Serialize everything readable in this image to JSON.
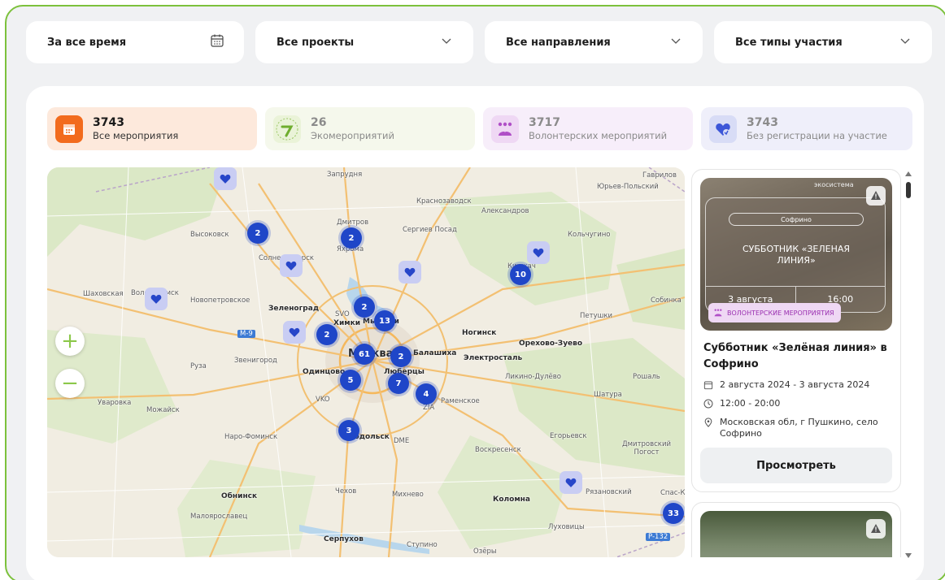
{
  "filters": {
    "period": "За все время",
    "projects": "Все проекты",
    "directions": "Все направления",
    "types": "Все типы участия"
  },
  "stats": [
    {
      "value": "3743",
      "label": "Все мероприятия",
      "icon": "calendar-icon",
      "color": "#f26b1d"
    },
    {
      "value": "26",
      "label": "Экомероприятий",
      "icon": "eco-logo-icon",
      "color": "#7cc13c"
    },
    {
      "value": "3717",
      "label": "Волонтерских мероприятий",
      "icon": "people-icon",
      "color": "#b04fc7"
    },
    {
      "value": "3743",
      "label": "Без регистрации на участие",
      "icon": "heart-icon",
      "color": "#3c56d8"
    }
  ],
  "map": {
    "places": [
      {
        "name": "Запрудня"
      },
      {
        "name": "Гаврилов"
      },
      {
        "name": "Юрьев-Польский"
      },
      {
        "name": "Краснозаводск"
      },
      {
        "name": "Александров"
      },
      {
        "name": "Дмитров"
      },
      {
        "name": "Сергиев Посад"
      },
      {
        "name": "Высоковск"
      },
      {
        "name": "Кольчугино"
      },
      {
        "name": "Солнечногорск"
      },
      {
        "name": "Яхрома"
      },
      {
        "name": "Киржач"
      },
      {
        "name": "Шаховская"
      },
      {
        "name": "Волоколамск"
      },
      {
        "name": "Новопетровское"
      },
      {
        "name": "Зеленоград"
      },
      {
        "name": "SVO"
      },
      {
        "name": "Химки"
      },
      {
        "name": "Мытищи"
      },
      {
        "name": "Собинка"
      },
      {
        "name": "Петушки"
      },
      {
        "name": "Ногинск"
      },
      {
        "name": "Орехово-Зуево"
      },
      {
        "name": "Руза"
      },
      {
        "name": "Звенигород"
      },
      {
        "name": "Москва"
      },
      {
        "name": "Балашиха"
      },
      {
        "name": "Электросталь"
      },
      {
        "name": "Одинцово"
      },
      {
        "name": "Люберцы"
      },
      {
        "name": "Ликино-Дулёво"
      },
      {
        "name": "Рошаль"
      },
      {
        "name": "Уваровка"
      },
      {
        "name": "Можайск"
      },
      {
        "name": "VKO"
      },
      {
        "name": "Раменское"
      },
      {
        "name": "Шатура"
      },
      {
        "name": "ZIA"
      },
      {
        "name": "Наро-Фоминск"
      },
      {
        "name": "Подольск"
      },
      {
        "name": "DME"
      },
      {
        "name": "Воскресенск"
      },
      {
        "name": "Егорьевск"
      },
      {
        "name": "Дмитровский Погост"
      },
      {
        "name": "Обнинск"
      },
      {
        "name": "Чехов"
      },
      {
        "name": "Михнево"
      },
      {
        "name": "Коломна"
      },
      {
        "name": "Рязановский"
      },
      {
        "name": "Спас-Клепики"
      },
      {
        "name": "Малоярославец"
      },
      {
        "name": "Луховицы"
      },
      {
        "name": "Серпухов"
      },
      {
        "name": "Ступино"
      },
      {
        "name": "Озёры"
      },
      {
        "name": "M-9"
      },
      {
        "name": "P-132"
      }
    ],
    "clusters": [
      "2",
      "2",
      "10",
      "2",
      "13",
      "2",
      "61",
      "2",
      "5",
      "7",
      "4",
      "3",
      "33"
    ],
    "zoom_in": "+",
    "zoom_out": "−"
  },
  "events": [
    {
      "image_title": "СУББОТНИК «ЗЕЛЕНАЯ ЛИНИЯ»",
      "image_search": "Софрино",
      "image_date": "3 августа",
      "image_time": "16:00",
      "image_brand": "экосистема",
      "tag": "ВОЛОНТЕРСКИЕ МЕРОПРИЯТИЯ",
      "title": "Субботник «Зелёная линия» в Софрино",
      "dates": "2 августа 2024 - 3 августа 2024",
      "time": "12:00 - 20:00",
      "address": "Московская обл, г Пушкино, село Софрино",
      "button": "Просмотреть"
    }
  ]
}
